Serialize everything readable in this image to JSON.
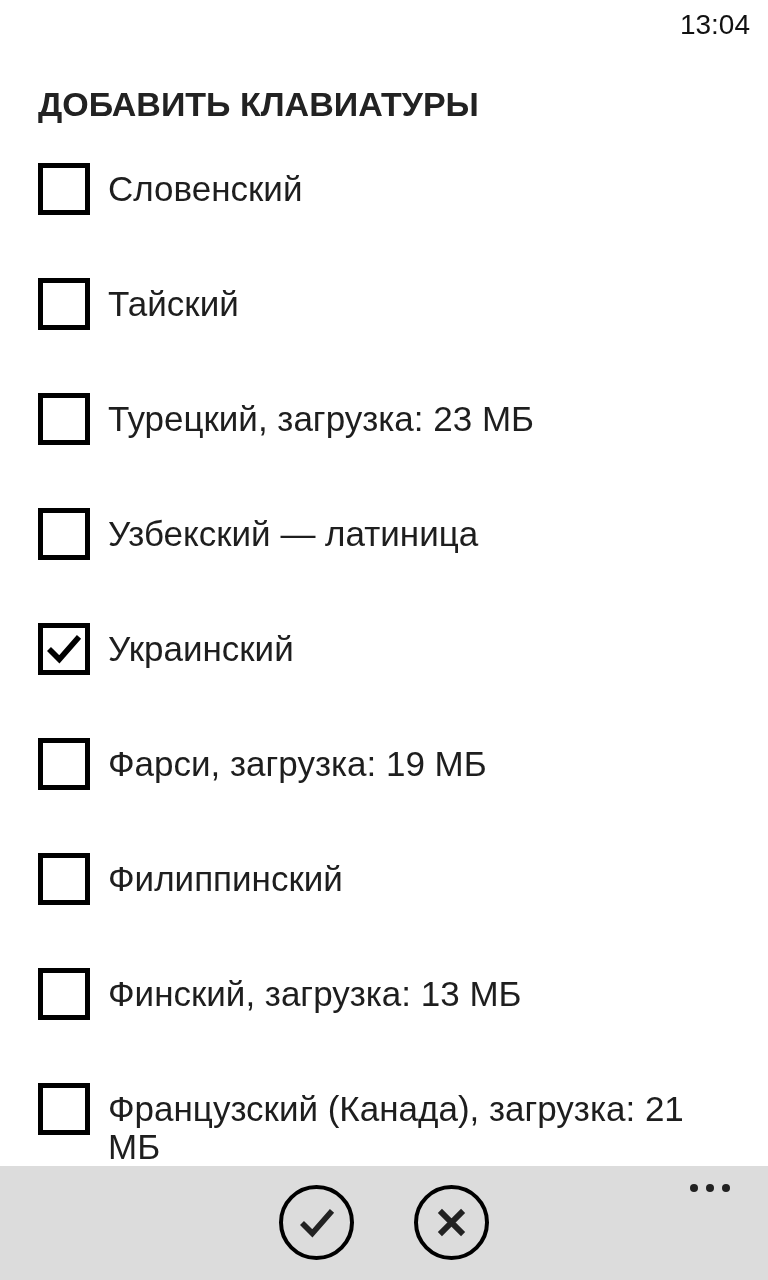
{
  "status_bar": {
    "time": "13:04"
  },
  "page": {
    "title": "ДОБАВИТЬ КЛАВИАТУРЫ"
  },
  "keyboards": [
    {
      "label": "Словенский",
      "checked": false
    },
    {
      "label": "Тайский",
      "checked": false
    },
    {
      "label": "Турецкий, загрузка: 23 МБ",
      "checked": false
    },
    {
      "label": "Узбекский — латиница",
      "checked": false
    },
    {
      "label": "Украинский",
      "checked": true
    },
    {
      "label": "Фарси, загрузка: 19 МБ",
      "checked": false
    },
    {
      "label": "Филиппинский",
      "checked": false
    },
    {
      "label": "Финский, загрузка: 13 МБ",
      "checked": false
    },
    {
      "label": "Французский (Канада), загрузка: 21 МБ",
      "checked": false
    }
  ],
  "app_bar": {
    "buttons": [
      {
        "kind": "confirm"
      },
      {
        "kind": "cancel"
      }
    ],
    "overflow_menu": true
  }
}
